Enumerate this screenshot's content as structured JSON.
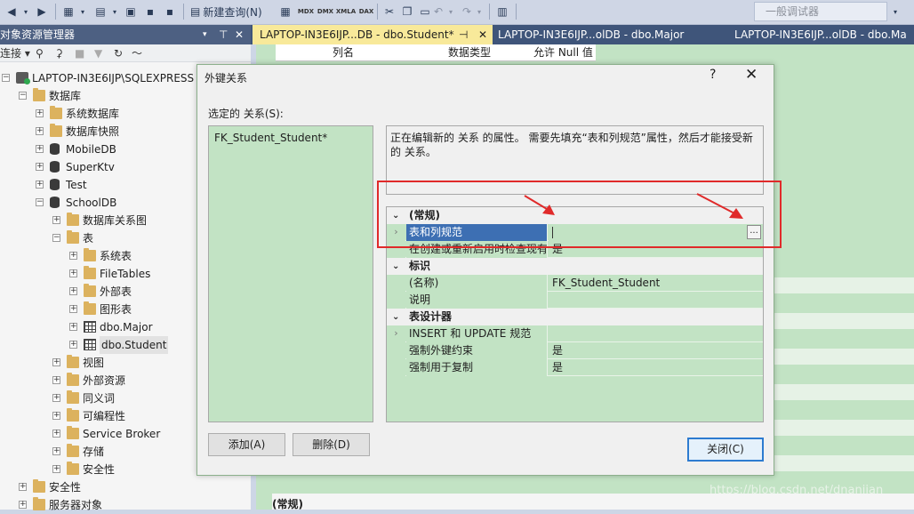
{
  "toolbar": {
    "new_query": "新建查询(N)",
    "mdx": "MDX",
    "dmx": "DMX",
    "xmla": "XMLA",
    "dax": "DAX",
    "debugger_combo": "一般调试器"
  },
  "explorer": {
    "title": "对象资源管理器",
    "pin": "⊤",
    "close": "✕",
    "connect": "连接 ▾",
    "tree": [
      {
        "label": "LAPTOP-IN3E6IJP\\SQLEXPRESS (S",
        "icon": "server-icon"
      },
      {
        "label": "数据库",
        "icon": "folder-icon"
      },
      {
        "label": "系统数据库",
        "icon": "folder-icon"
      },
      {
        "label": "数据库快照",
        "icon": "folder-icon"
      },
      {
        "label": "MobileDB",
        "icon": "database-icon"
      },
      {
        "label": "SuperKtv",
        "icon": "database-icon"
      },
      {
        "label": "Test",
        "icon": "database-icon"
      },
      {
        "label": "SchoolDB",
        "icon": "database-icon"
      },
      {
        "label": "数据库关系图",
        "icon": "folder-icon"
      },
      {
        "label": "表",
        "icon": "folder-icon"
      },
      {
        "label": "系统表",
        "icon": "folder-icon"
      },
      {
        "label": "FileTables",
        "icon": "folder-icon"
      },
      {
        "label": "外部表",
        "icon": "folder-icon"
      },
      {
        "label": "图形表",
        "icon": "folder-icon"
      },
      {
        "label": "dbo.Major",
        "icon": "table-icon"
      },
      {
        "label": "dbo.Student",
        "icon": "table-icon"
      },
      {
        "label": "视图",
        "icon": "folder-icon"
      },
      {
        "label": "外部资源",
        "icon": "folder-icon"
      },
      {
        "label": "同义词",
        "icon": "folder-icon"
      },
      {
        "label": "可编程性",
        "icon": "folder-icon"
      },
      {
        "label": "Service Broker",
        "icon": "folder-icon"
      },
      {
        "label": "存储",
        "icon": "folder-icon"
      },
      {
        "label": "安全性",
        "icon": "folder-icon"
      },
      {
        "label": "安全性",
        "icon": "folder-icon"
      },
      {
        "label": "服务器对象",
        "icon": "folder-icon"
      }
    ]
  },
  "tabs": [
    {
      "label": "LAPTOP-IN3E6IJP...DB - dbo.Student*",
      "pin": "⊣",
      "close": "✕"
    },
    {
      "label": "LAPTOP-IN3E6IJP...olDB - dbo.Major"
    },
    {
      "label": "LAPTOP-IN3E6IJP...olDB - dbo.Ma"
    }
  ],
  "table_designer": {
    "columns": [
      "列名",
      "数据类型",
      "允许 Null 值"
    ],
    "bottom_label": "(常规)",
    "watermark": "https://blog.csdn.net/dnanjian"
  },
  "dialog": {
    "title": "外键关系",
    "help": "?",
    "close": "✕",
    "selected_label": "选定的 关系(S):",
    "relationships": [
      "FK_Student_Student*"
    ],
    "description": "正在编辑新的 关系 的属性。 需要先填充“表和列规范”属性，然后才能接受新的 关系。",
    "grid": {
      "cat_general": "(常规)",
      "row_tables": "表和列规范",
      "row_check": "在创建或重新启用时检查现有",
      "row_check_val": "是",
      "cat_identity": "标识",
      "row_name": "(名称)",
      "row_name_val": "FK_Student_Student",
      "row_desc": "说明",
      "cat_designer": "表设计器",
      "row_insert": "INSERT 和 UPDATE 规范",
      "row_enforce": "强制外键约束",
      "row_enforce_val": "是",
      "row_repl": "强制用于复制",
      "row_repl_val": "是",
      "ellipsis": "..."
    },
    "add_button": "添加(A)",
    "delete_button": "删除(D)",
    "close_button": "关闭(C)"
  },
  "colors": {
    "accent_blue": "#3d6fb3",
    "grid_green": "#c2e3c4",
    "annotation_red": "#e02a2a"
  }
}
